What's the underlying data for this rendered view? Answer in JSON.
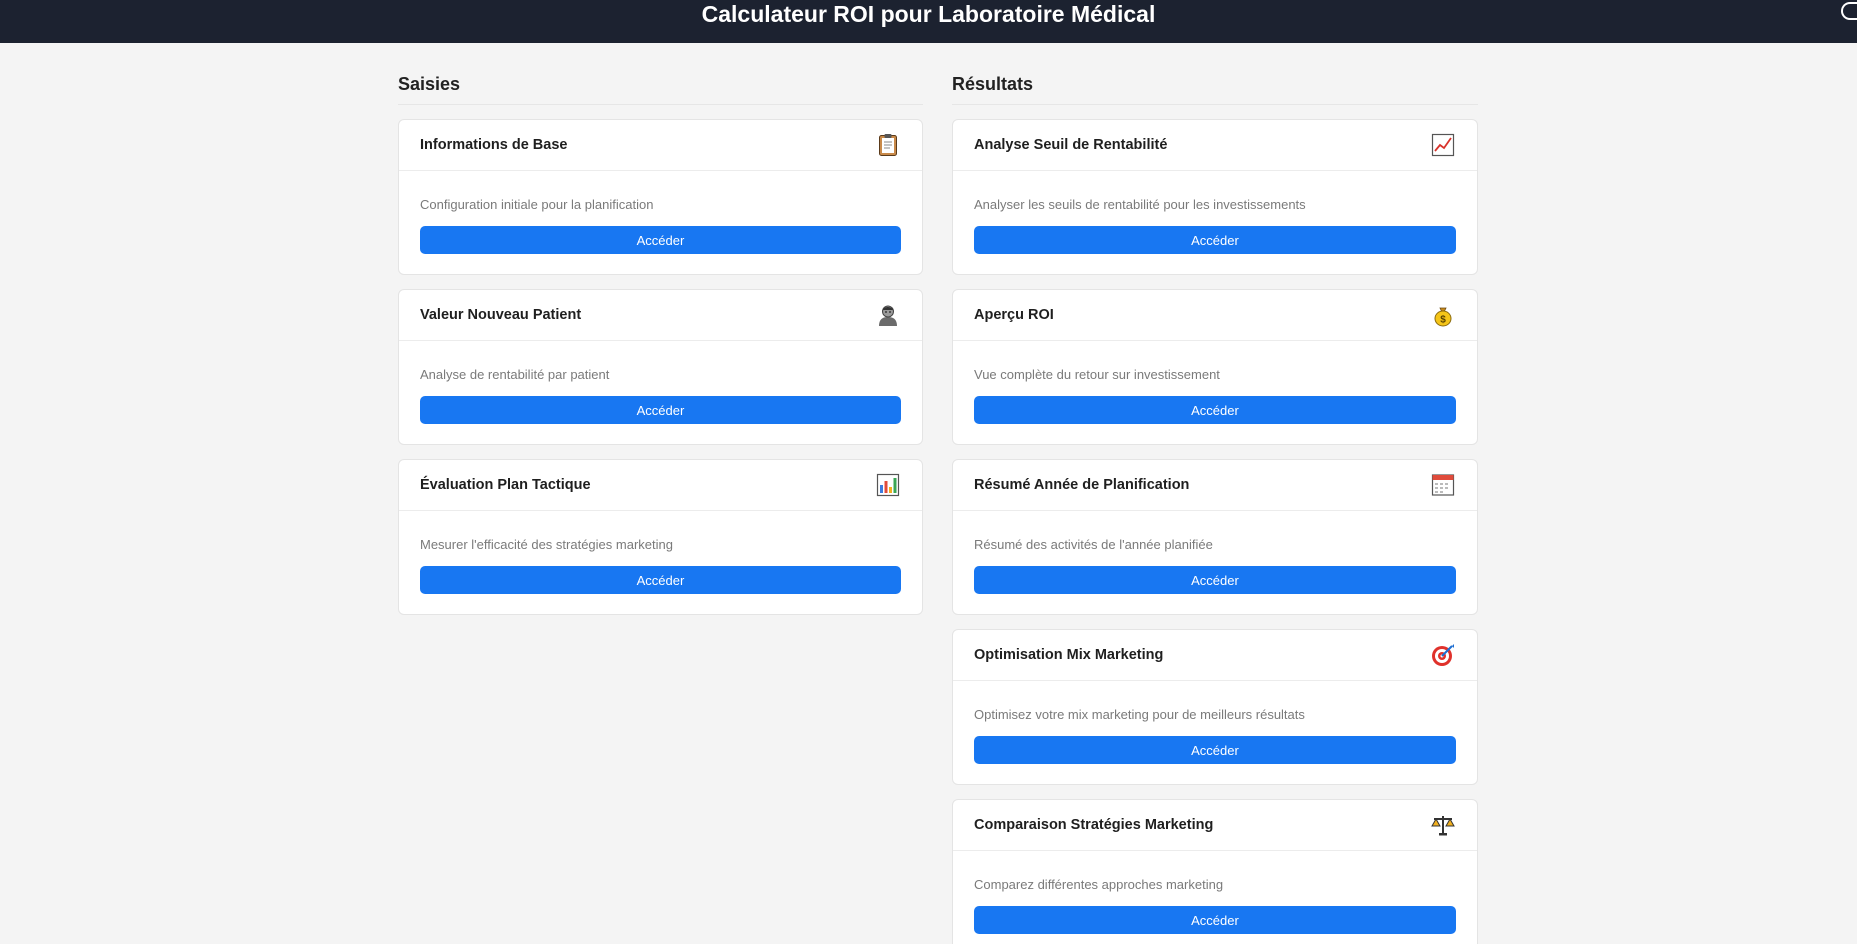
{
  "header": {
    "title": "Calculateur ROI pour Laboratoire Médical"
  },
  "button_label": "Accéder",
  "inputs": {
    "heading": "Saisies",
    "cards": [
      {
        "title": "Informations de Base",
        "description": "Configuration initiale pour la planification",
        "icon": "clipboard-icon"
      },
      {
        "title": "Valeur Nouveau Patient",
        "description": "Analyse de rentabilité par patient",
        "icon": "patient-icon"
      },
      {
        "title": "Évaluation Plan Tactique",
        "description": "Mesurer l'efficacité des stratégies marketing",
        "icon": "bar-chart-icon"
      }
    ]
  },
  "results": {
    "heading": "Résultats",
    "cards": [
      {
        "title": "Analyse Seuil de Rentabilité",
        "description": "Analyser les seuils de rentabilité pour les investissements",
        "icon": "trend-chart-icon"
      },
      {
        "title": "Aperçu ROI",
        "description": "Vue complète du retour sur investissement",
        "icon": "money-bag-icon"
      },
      {
        "title": "Résumé Année de Planification",
        "description": "Résumé des activités de l'année planifiée",
        "icon": "calendar-icon"
      },
      {
        "title": "Optimisation Mix Marketing",
        "description": "Optimisez votre mix marketing pour de meilleurs résultats",
        "icon": "target-icon"
      },
      {
        "title": "Comparaison Stratégies Marketing",
        "description": "Comparez différentes approches marketing",
        "icon": "balance-scale-icon"
      }
    ]
  },
  "colors": {
    "header_bg": "#1c2230",
    "button": "#1877f2",
    "page_bg": "#f4f4f4"
  }
}
